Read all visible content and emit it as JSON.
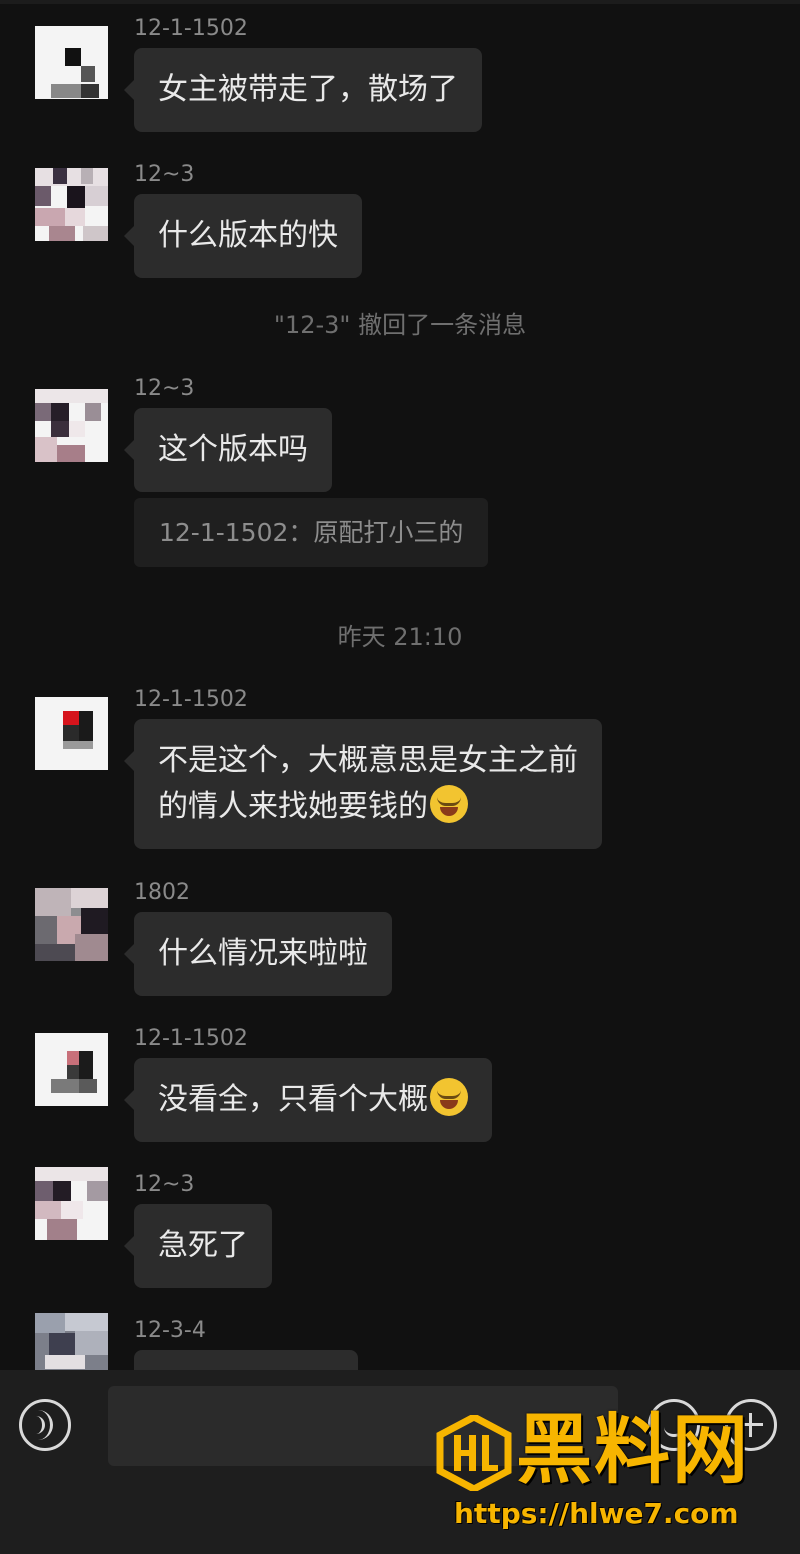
{
  "messages": [
    {
      "sender": "12-1-1502",
      "lines": [
        "女主被带走了，散场了"
      ]
    },
    {
      "sender": "12~3",
      "lines": [
        "什么版本的快"
      ]
    },
    {
      "sender": "12~3",
      "lines": [
        "这个版本吗"
      ]
    },
    {
      "sender": "12-1-1502",
      "lines": [
        "不是这个，大概意思是女主之前",
        "的情人来找她要钱的"
      ],
      "emoji": "face-with-tears-of-joy"
    },
    {
      "sender": "1802",
      "lines": [
        "什么情况来啦啦"
      ]
    },
    {
      "sender": "12-1-1502",
      "lines": [
        "没看全，只看个大概"
      ],
      "emoji": "face-with-tears-of-joy"
    },
    {
      "sender": "12~3",
      "lines": [
        "急死了"
      ]
    },
    {
      "sender": "12-3-4",
      "lines": []
    }
  ],
  "system": {
    "recall_notice": "\"12-3\" 撤回了一条消息",
    "timestamp": "昨天 21:10"
  },
  "quote": {
    "text": "12-1-1502：原配打小三的"
  },
  "input_bar": {
    "text_value": "",
    "voice_icon": "voice-icon",
    "emoji_icon": "emoji-icon",
    "plus_icon": "plus-icon"
  },
  "watermark": {
    "title": "黑料网",
    "url": "https://hlwe7.com",
    "logo_text": "HL"
  },
  "colors": {
    "background": "#111111",
    "bubble": "#2c2c2c",
    "text": "#e9e9e9",
    "meta": "#8a8a8a",
    "watermark": "#f7b500"
  }
}
